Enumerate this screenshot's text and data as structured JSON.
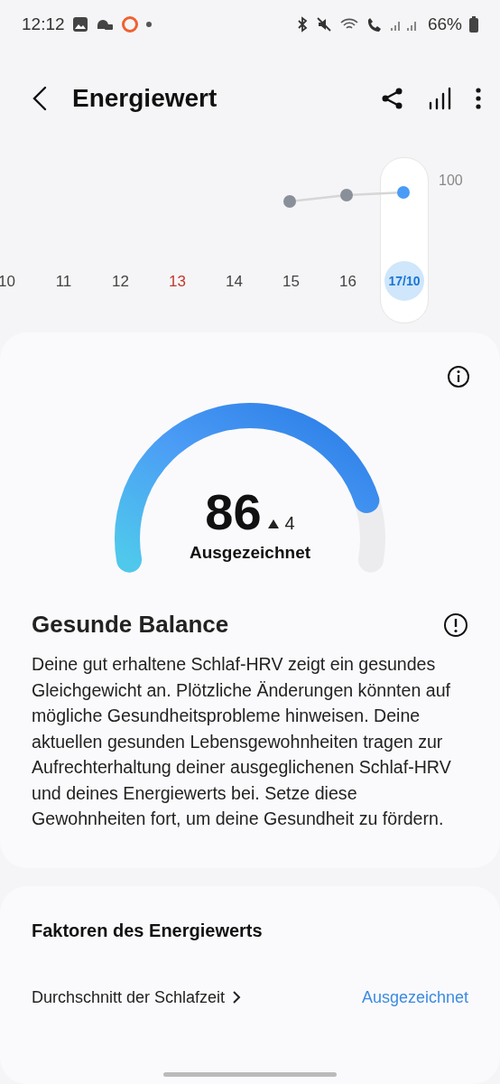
{
  "status_bar": {
    "time": "12:12",
    "battery": "66%"
  },
  "header": {
    "title": "Energiewert"
  },
  "chart": {
    "top_label": "100",
    "days": [
      {
        "label": "10",
        "selected": false,
        "color": "#444444"
      },
      {
        "label": "11",
        "selected": false,
        "color": "#444444"
      },
      {
        "label": "12",
        "selected": false,
        "color": "#444444"
      },
      {
        "label": "13",
        "selected": false,
        "color": "#c0392b"
      },
      {
        "label": "14",
        "selected": false,
        "color": "#444444"
      },
      {
        "label": "15",
        "selected": false,
        "color": "#444444"
      },
      {
        "label": "16",
        "selected": false,
        "color": "#444444"
      },
      {
        "label": "17/10",
        "selected": true,
        "color": "#1976d2"
      }
    ]
  },
  "score": {
    "value": "86",
    "change": "4",
    "rating": "Ausgezeichnet"
  },
  "summary": {
    "title": "Gesunde Balance",
    "text": "Deine gut erhaltene Schlaf-HRV zeigt ein gesundes Gleichgewicht an. Plötzliche Änderungen könnten auf mögliche Gesundheitsprobleme hinweisen. Deine aktuellen gesunden Lebensgewohnheiten tragen zur Aufrechterhaltung deiner ausgeglichenen Schlaf-HRV und deines Energiewerts bei. Setze diese Gewohnheiten fort, um deine Gesundheit zu fördern."
  },
  "factors": {
    "title": "Faktoren des Energiewerts",
    "items": [
      {
        "label": "Durchschnitt der Schlafzeit",
        "value": "Ausgezeichnet"
      }
    ]
  }
}
